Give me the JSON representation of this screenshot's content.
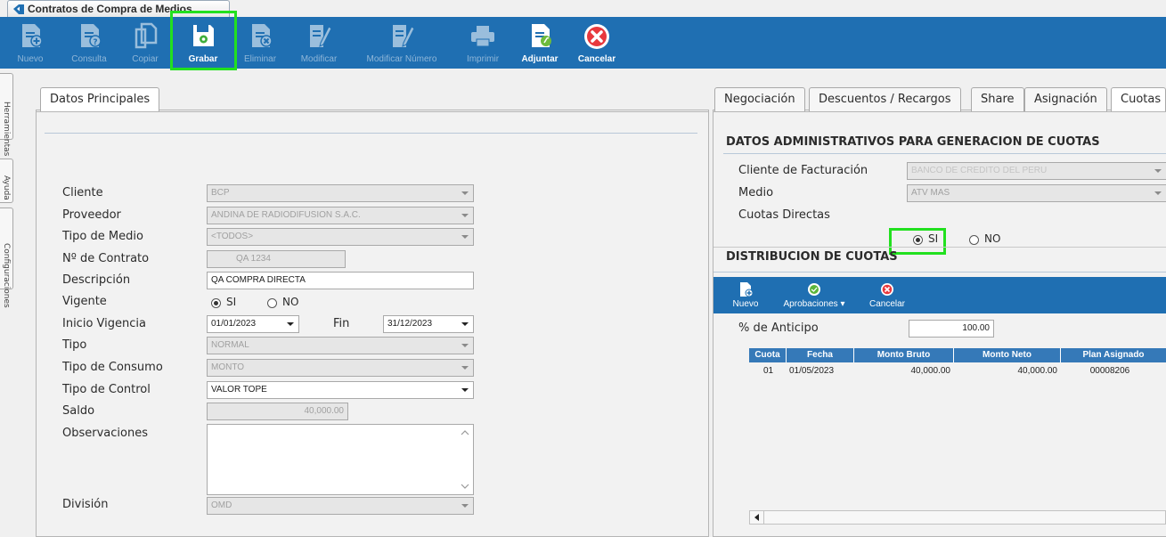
{
  "window": {
    "title": "Contratos de Compra de Medios"
  },
  "toolbar": {
    "buttons": [
      {
        "label": "Nuevo"
      },
      {
        "label": "Consulta"
      },
      {
        "label": "Copiar"
      },
      {
        "label": "Grabar"
      },
      {
        "label": "Eliminar"
      },
      {
        "label": "Modificar"
      },
      {
        "label": "Modificar Número"
      },
      {
        "label": "Imprimir"
      },
      {
        "label": "Adjuntar"
      },
      {
        "label": "Cancelar"
      }
    ]
  },
  "side_tabs": [
    "Herramientas",
    "Ayuda",
    "Configuraciones"
  ],
  "left": {
    "tab": "Datos Principales",
    "labels": {
      "cliente": "Cliente",
      "proveedor": "Proveedor",
      "tipo_medio": "Tipo de Medio",
      "nro_contrato": "Nº de Contrato",
      "descripcion": "Descripción",
      "vigente": "Vigente",
      "inicio_vigencia": "Inicio Vigencia",
      "fin": "Fin",
      "tipo": "Tipo",
      "tipo_consumo": "Tipo de Consumo",
      "tipo_control": "Tipo de Control",
      "saldo": "Saldo",
      "observaciones": "Observaciones",
      "division": "División"
    },
    "values": {
      "cliente": "BCP",
      "proveedor": "ANDINA DE RADIODIFUSION S.A.C.",
      "tipo_medio": "<TODOS>",
      "nro_contrato": "QA 1234",
      "descripcion": "QA COMPRA DIRECTA",
      "vigente_si": "SI",
      "vigente_no": "NO",
      "inicio_vigencia": "01/01/2023",
      "fin": "31/12/2023",
      "tipo": "NORMAL",
      "tipo_consumo": "MONTO",
      "tipo_control": "VALOR TOPE",
      "saldo": "40,000.00",
      "observaciones": "",
      "division": "OMD"
    }
  },
  "right": {
    "tabs": [
      "Negociación",
      "Descuentos / Recargos",
      "Share",
      "Asignación",
      "Cuotas"
    ],
    "admin_title": "DATOS ADMINISTRATIVOS PARA GENERACION DE CUOTAS",
    "labels": {
      "cliente_facturacion": "Cliente de Facturación",
      "medio": "Medio",
      "cuotas_directas": "Cuotas Directas",
      "anticipo": "% de Anticipo"
    },
    "values": {
      "cliente_facturacion": "BANCO DE CREDITO DEL PERU",
      "medio": "ATV MAS",
      "si": "SI",
      "no": "NO",
      "anticipo": "100.00"
    },
    "dist_title": "DISTRIBUCION DE CUOTAS",
    "cuotas_toolbar": {
      "nuevo": "Nuevo",
      "aprobaciones": "Aprobaciones",
      "cancelar": "Cancelar"
    },
    "grid": {
      "columns": [
        "Cuota",
        "Fecha",
        "Monto Bruto",
        "Monto Neto",
        "Plan Asignado"
      ],
      "rows": [
        [
          "01",
          "01/05/2023",
          "40,000.00",
          "40,000.00",
          "00008206"
        ]
      ]
    }
  },
  "colors": {
    "toolbar_blue": "#1f6fb2",
    "highlight_green": "#22e01f",
    "grid_header": "#3579b8"
  }
}
